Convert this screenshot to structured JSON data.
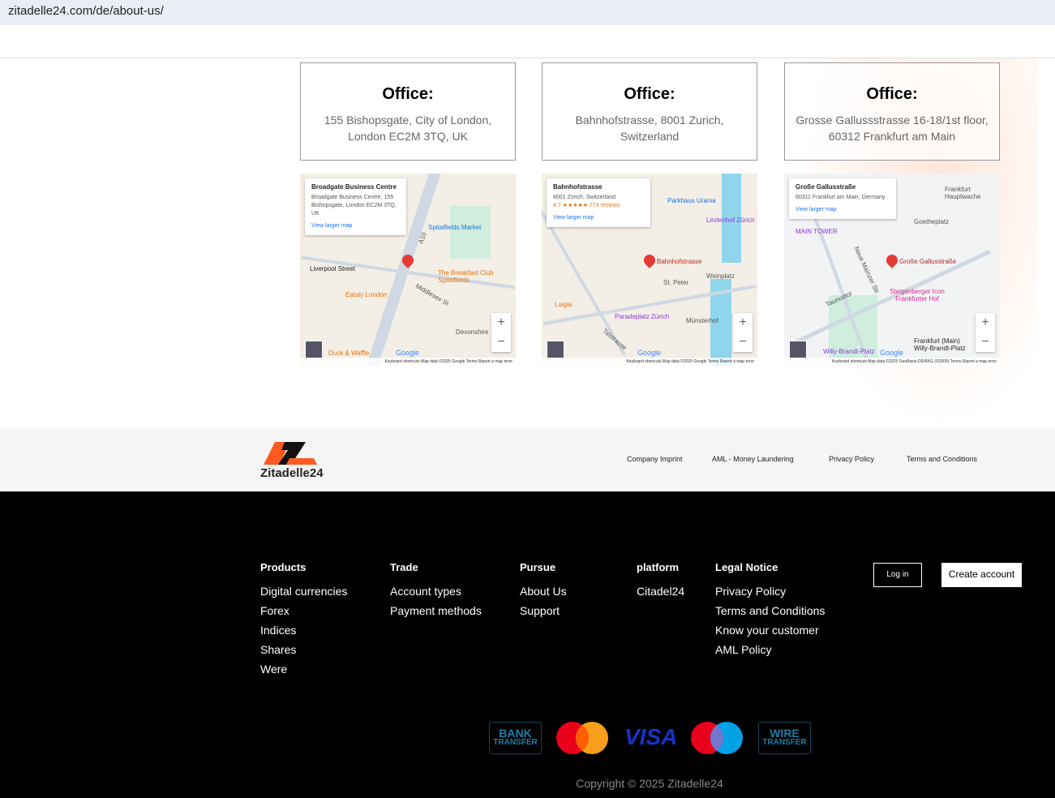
{
  "browser": {
    "url": "zitadelle24.com/de/about-us/"
  },
  "offices": [
    {
      "title": "Office:",
      "address": "155 Bishopsgate, City of London, London EC2M 3TQ, UK"
    },
    {
      "title": "Office:",
      "address": "Bahnhofstrasse, 8001 Zurich, Switzerland"
    },
    {
      "title": "Office:",
      "address": "Grosse Gallussstrasse 16-18/1st floor, 60312 Frankfurt am Main"
    }
  ],
  "maps": [
    {
      "place": "Broadgate Business Centre",
      "address": "Broadgate Business Centre, 155 Bishopsgate, London EC2M 3TQ, UK",
      "rating": "",
      "link": "View larger map",
      "pin": "",
      "labels": [
        "Liverpool Street",
        "Spitalfields Market",
        "The Breakfast Club Spitalfields",
        "Eataly London",
        "Devonshire",
        "Duck & Waffle",
        "Middlesex St",
        "A10"
      ],
      "attribution": "Keyboard shortcuts   Map data ©2025 Google   Terms   Report a map error"
    },
    {
      "place": "Bahnhofstrasse",
      "address": "8001 Zürich, Switzerland",
      "rating": "4.7 ★★★★★  774 reviews",
      "link": "View larger map",
      "pin": "Bahnhofstrasse",
      "labels": [
        "Parkhaus Urania",
        "Lindenhof Zürich",
        "St. Peter",
        "Weinplatz",
        "Luigia",
        "Paradeplatz Zürich",
        "Münsterhof",
        "Talstrasse"
      ],
      "attribution": "Keyboard shortcuts   Map data ©2025 Google   Terms   Report a map error"
    },
    {
      "place": "Große Gallusstraße",
      "address": "60311 Frankfurt am Main, Germany",
      "rating": "",
      "link": "View larger map",
      "pin": "Große Gallusstraße",
      "labels": [
        "Frankfurt Hauptwache",
        "Goetheplatz",
        "MAIN TOWER",
        "Steigenberger Icon Frankfurter Hof",
        "Frankfurt (Main) Willy-Brandt-Platz",
        "Willy-Brandt-Platz",
        "Taunustor",
        "Neue Mainzer Str."
      ],
      "attribution": "Keyboard shortcuts   Map data ©2025 GeoBasis-DE/BKG (©2009)   Terms   Report a map error"
    }
  ],
  "map_ui": {
    "google": "Google",
    "zoom_in": "+",
    "zoom_out": "−"
  },
  "brand": {
    "name": "Zitadelle24"
  },
  "footer_links": [
    "Company Imprint",
    "AML - Money Laundering",
    "Privacy Policy",
    "Terms and Conditions"
  ],
  "columns": [
    {
      "heading": "Products",
      "items": [
        "Digital currencies",
        "Forex",
        "Indices",
        "Shares",
        "Were"
      ]
    },
    {
      "heading": "Trade",
      "items": [
        "Account types",
        "Payment methods"
      ]
    },
    {
      "heading": "Pursue",
      "items": [
        "About Us",
        "Support"
      ]
    },
    {
      "heading": "platform",
      "items": [
        "Citadel24"
      ]
    },
    {
      "heading": "Legal Notice",
      "items": [
        "Privacy Policy",
        "Terms and Conditions",
        "Know your customer",
        "AML Policy"
      ]
    }
  ],
  "auth": {
    "login": "Log in",
    "create": "Create account"
  },
  "payments": {
    "bank1": "BANK",
    "bank2": "TRANSFER",
    "visa": "VISA",
    "wire1": "WIRE",
    "wire2": "TRANSFER"
  },
  "copyright": "Copyright © 2025 Zitadelle24"
}
